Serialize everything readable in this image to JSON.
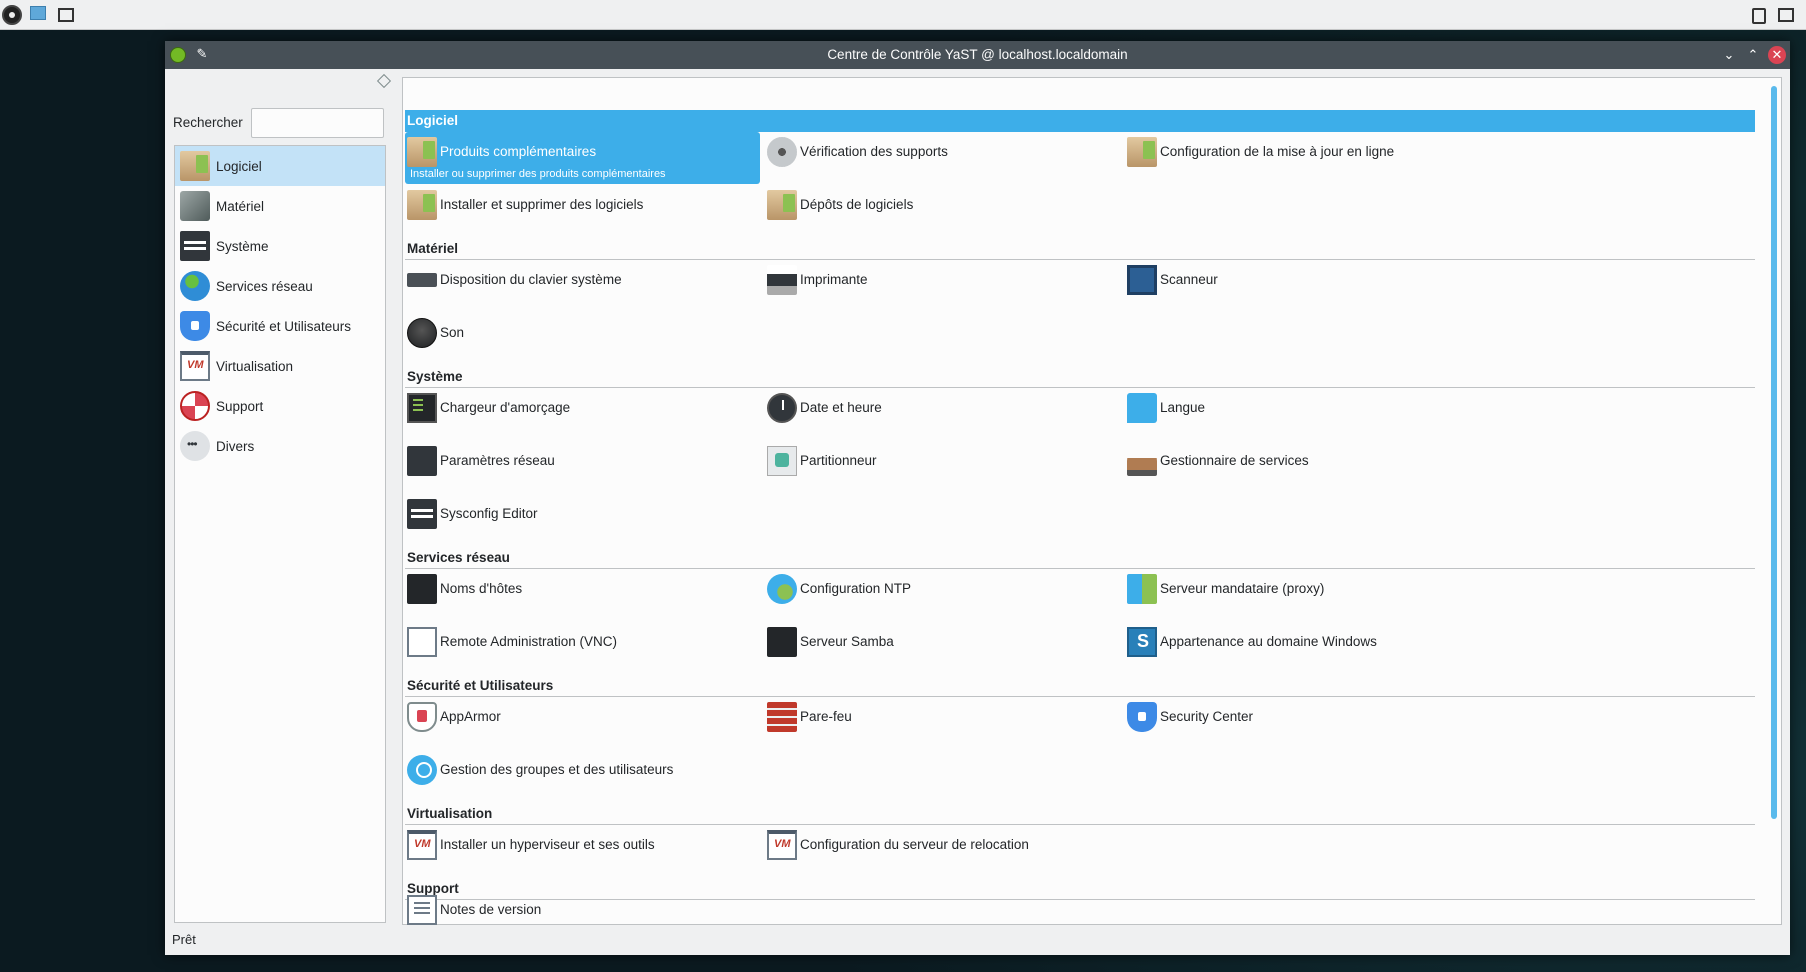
{
  "window": {
    "title": "Centre de Contrôle YaST @ localhost.localdomain"
  },
  "sidebar": {
    "search_label": "Rechercher",
    "search_value": "",
    "categories": [
      {
        "label": "Logiciel",
        "icon": "package-icon"
      },
      {
        "label": "Matériel",
        "icon": "hardware-icon"
      },
      {
        "label": "Système",
        "icon": "system-icon"
      },
      {
        "label": "Services réseau",
        "icon": "globe-icon"
      },
      {
        "label": "Sécurité et Utilisateurs",
        "icon": "shield-icon"
      },
      {
        "label": "Virtualisation",
        "icon": "vm-icon"
      },
      {
        "label": "Support",
        "icon": "lifebuoy-icon"
      },
      {
        "label": "Divers",
        "icon": "more-icon"
      }
    ]
  },
  "sections": {
    "logiciel": {
      "title": "Logiciel",
      "items": [
        {
          "label": "Produits complémentaires",
          "description": "Installer ou supprimer des produits complémentaires"
        },
        {
          "label": "Vérification des supports"
        },
        {
          "label": "Configuration de la mise à jour en ligne"
        },
        {
          "label": "Installer et supprimer des logiciels"
        },
        {
          "label": "Dépôts de logiciels"
        }
      ]
    },
    "materiel": {
      "title": "Matériel",
      "items": [
        {
          "label": "Disposition du clavier système"
        },
        {
          "label": "Imprimante"
        },
        {
          "label": "Scanneur"
        },
        {
          "label": "Son"
        }
      ]
    },
    "systeme": {
      "title": "Système",
      "items": [
        {
          "label": "Chargeur d'amorçage"
        },
        {
          "label": "Date et heure"
        },
        {
          "label": "Langue"
        },
        {
          "label": "Paramètres réseau"
        },
        {
          "label": "Partitionneur"
        },
        {
          "label": "Gestionnaire de services"
        },
        {
          "label": "Sysconfig Editor"
        }
      ]
    },
    "reseau": {
      "title": "Services réseau",
      "items": [
        {
          "label": "Noms d'hôtes"
        },
        {
          "label": "Configuration NTP"
        },
        {
          "label": "Serveur mandataire (proxy)"
        },
        {
          "label": "Remote Administration (VNC)"
        },
        {
          "label": "Serveur Samba"
        },
        {
          "label": "Appartenance au domaine Windows"
        }
      ]
    },
    "securite": {
      "title": "Sécurité et Utilisateurs",
      "items": [
        {
          "label": "AppArmor"
        },
        {
          "label": "Pare-feu"
        },
        {
          "label": "Security Center"
        },
        {
          "label": "Gestion des groupes et des utilisateurs"
        }
      ]
    },
    "virtualisation": {
      "title": "Virtualisation",
      "items": [
        {
          "label": "Installer un hyperviseur et ses outils"
        },
        {
          "label": "Configuration du serveur de relocation"
        }
      ]
    },
    "support": {
      "title": "Support",
      "items": [
        {
          "label": "Notes de version"
        }
      ]
    }
  },
  "status": {
    "text": "Prêt"
  },
  "colors": {
    "accent": "#3daee9",
    "selected_category": "#c3e2f7",
    "titlebar": "#475057"
  }
}
